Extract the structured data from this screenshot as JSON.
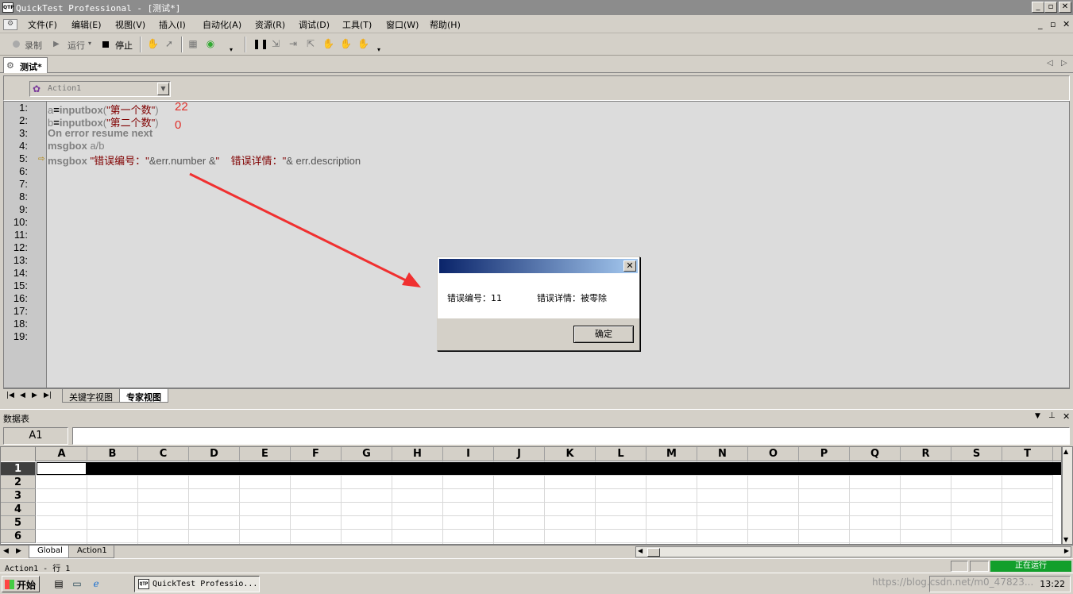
{
  "window": {
    "title": "QuickTest Professional - [测试*]",
    "app_icon": "QTP",
    "controls": [
      "_",
      "▫",
      "✕"
    ]
  },
  "menu": {
    "items": [
      "文件(F)",
      "编辑(E)",
      "视图(V)",
      "插入(I)",
      "自动化(A)",
      "资源(R)",
      "调试(D)",
      "工具(T)",
      "窗口(W)",
      "帮助(H)"
    ],
    "mdi_controls": [
      "_",
      "▫",
      "✕"
    ]
  },
  "toolbar": {
    "record_label": "录制",
    "run_label": "运行",
    "stop_label": "停止"
  },
  "document_tab": {
    "label": "测试*"
  },
  "action_selector": {
    "value": "Action1"
  },
  "editor": {
    "line_numbers": [
      "1:",
      "2:",
      "3:",
      "4:",
      "5:",
      "6:",
      "7:",
      "8:",
      "9:",
      "10:",
      "11:",
      "12:",
      "13:",
      "14:",
      "15:",
      "16:",
      "17:",
      "18:",
      "19:"
    ],
    "lines": [
      {
        "a": "a",
        "b": "=",
        "c": "inputbox",
        "d": "(",
        "e": "\"第一个数\"",
        "f": ")"
      },
      {
        "a": "b",
        "b": "=",
        "c": "inputbox",
        "d": "(",
        "e": "\"第二个数\"",
        "f": ")"
      },
      {
        "text": "On error resume next"
      },
      {
        "a": "msgbox",
        "b": " a/b"
      },
      {
        "a": "msgbox",
        "b": " \"错误编号：\"",
        "c": "&err.number &",
        "d": "\"    错误详情：\"",
        "e": "& err.description"
      }
    ],
    "annotations": [
      "22",
      "0"
    ],
    "current_line": 5
  },
  "view_tabs": [
    "关键字视图",
    "专家视图"
  ],
  "datatable": {
    "title": "数据表",
    "cell_ref": "A1",
    "columns": [
      "A",
      "B",
      "C",
      "D",
      "E",
      "F",
      "G",
      "H",
      "I",
      "J",
      "K",
      "L",
      "M",
      "N",
      "O",
      "P",
      "Q",
      "R",
      "S",
      "T"
    ],
    "rows": [
      "1",
      "2",
      "3",
      "4",
      "5",
      "6"
    ],
    "sheets": [
      "Global",
      "Action1"
    ]
  },
  "status": {
    "position": "Action1  - 行  1",
    "state": "正在运行"
  },
  "taskbar": {
    "start_label": "开始",
    "task_label": "QuickTest Professio...",
    "clock": "13:22",
    "watermark": "https://blog.csdn.net/m0_47823..."
  },
  "dialog": {
    "message_number": "错误编号：11",
    "message_detail": "错误详情：被零除",
    "ok_label": "确定"
  },
  "colors": {
    "running_status": "#129f2b",
    "annotation_red": "#e0302a",
    "string_color": "#800000"
  }
}
